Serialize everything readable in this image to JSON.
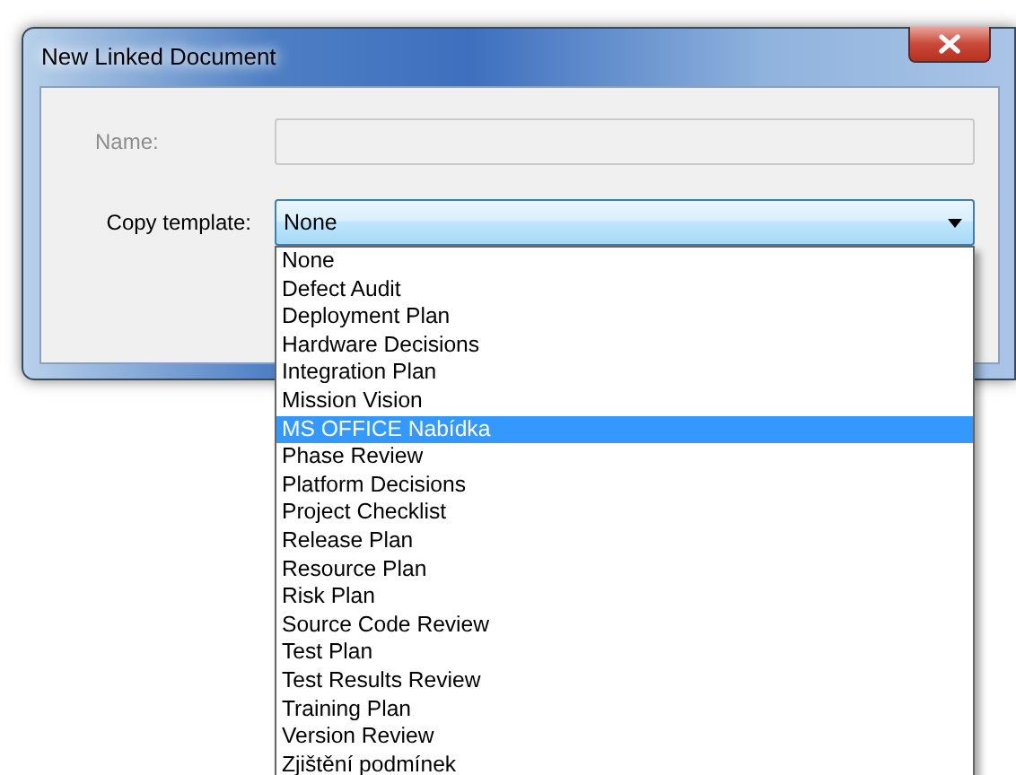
{
  "window": {
    "title": "New Linked Document"
  },
  "name_field": {
    "label": "Name:",
    "disabled": true
  },
  "copy_template": {
    "label": "Copy template:",
    "value": "None",
    "expanded": true,
    "options": [
      {
        "label": "None",
        "highlighted": false
      },
      {
        "label": "Defect Audit",
        "highlighted": false
      },
      {
        "label": "Deployment Plan",
        "highlighted": false
      },
      {
        "label": "Hardware Decisions",
        "highlighted": false
      },
      {
        "label": "Integration Plan",
        "highlighted": false
      },
      {
        "label": "Mission Vision",
        "highlighted": false
      },
      {
        "label": "MS OFFICE Nabídka",
        "highlighted": true
      },
      {
        "label": "Phase Review",
        "highlighted": false
      },
      {
        "label": "Platform Decisions",
        "highlighted": false
      },
      {
        "label": "Project Checklist",
        "highlighted": false
      },
      {
        "label": "Release Plan",
        "highlighted": false
      },
      {
        "label": "Resource Plan",
        "highlighted": false
      },
      {
        "label": "Risk Plan",
        "highlighted": false
      },
      {
        "label": "Source Code Review",
        "highlighted": false
      },
      {
        "label": "Test Plan",
        "highlighted": false
      },
      {
        "label": "Test Results Review",
        "highlighted": false
      },
      {
        "label": "Training Plan",
        "highlighted": false
      },
      {
        "label": "Version Review",
        "highlighted": false
      },
      {
        "label": "Zjištění podmínek",
        "highlighted": false
      }
    ]
  }
}
